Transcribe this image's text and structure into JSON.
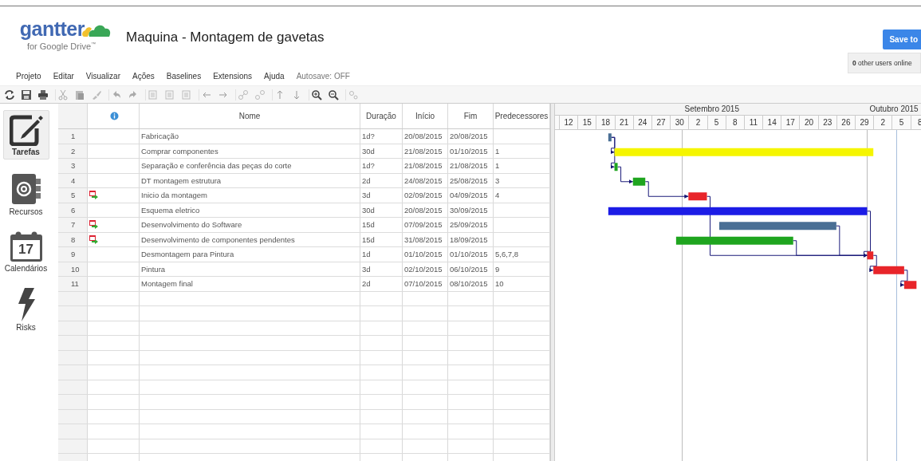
{
  "logo": {
    "name": "gantter",
    "subtitle": "for Google Drive$^{™}$"
  },
  "document_title": "Maquina - Montagem de gavetas",
  "save_button": "Save to",
  "online_users": {
    "count": "0",
    "label": "other users online"
  },
  "menu": [
    "Projeto",
    "Editar",
    "Visualizar",
    "Ações",
    "Baselines",
    "Extensions",
    "Ajuda"
  ],
  "autosave": "Autosave: OFF",
  "sidebar": {
    "items": [
      {
        "kind": "tasks",
        "label": "Tarefas",
        "selected": true
      },
      {
        "kind": "resources",
        "label": "Recursos",
        "selected": false
      },
      {
        "kind": "calendar",
        "label": "Calendários",
        "icon_text": "17",
        "selected": false
      },
      {
        "kind": "risks",
        "label": "Risks",
        "selected": false
      }
    ]
  },
  "table": {
    "columns": [
      "Nome",
      "Duração",
      "Início",
      "Fim",
      "Predecessores"
    ],
    "rows": [
      {
        "number": "1",
        "constraint": false,
        "name": "Fabricação",
        "duration": "1d?",
        "start": "20/08/2015",
        "end": "20/08/2015",
        "predecessors": "",
        "color": "#4a6f95"
      },
      {
        "number": "2",
        "constraint": false,
        "name": "Comprar componentes",
        "duration": "30d",
        "start": "21/08/2015",
        "end": "01/10/2015",
        "predecessors": "1",
        "color": "#f5f500"
      },
      {
        "number": "3",
        "constraint": false,
        "name": "Separação e conferência das peças do corte",
        "duration": "1d?",
        "start": "21/08/2015",
        "end": "21/08/2015",
        "predecessors": "1",
        "color": "#1fa51f"
      },
      {
        "number": "4",
        "constraint": false,
        "name": "DT montagem estrutura",
        "duration": "2d",
        "start": "24/08/2015",
        "end": "25/08/2015",
        "predecessors": "3",
        "color": "#1fa51f"
      },
      {
        "number": "5",
        "constraint": true,
        "name": "Inicio da montagem",
        "duration": "3d",
        "start": "02/09/2015",
        "end": "04/09/2015",
        "predecessors": "4",
        "color": "#e8252a"
      },
      {
        "number": "6",
        "constraint": false,
        "name": "Esquema eletrico",
        "duration": "30d",
        "start": "20/08/2015",
        "end": "30/09/2015",
        "predecessors": "",
        "color": "#1c1ce6"
      },
      {
        "number": "7",
        "constraint": true,
        "name": "Desenvolvimento do Software",
        "duration": "15d",
        "start": "07/09/2015",
        "end": "25/09/2015",
        "predecessors": "",
        "color": "#4a6f95"
      },
      {
        "number": "8",
        "constraint": true,
        "name": "Desenvolvimento de componentes pendentes",
        "duration": "15d",
        "start": "31/08/2015",
        "end": "18/09/2015",
        "predecessors": "",
        "color": "#1fa51f"
      },
      {
        "number": "9",
        "constraint": false,
        "name": "Desmontagem para Pintura",
        "duration": "1d",
        "start": "01/10/2015",
        "end": "01/10/2015",
        "predecessors": "5,6,7,8",
        "color": "#e8252a"
      },
      {
        "number": "10",
        "constraint": false,
        "name": "Pintura",
        "duration": "3d",
        "start": "02/10/2015",
        "end": "06/10/2015",
        "predecessors": "9",
        "color": "#e8252a"
      },
      {
        "number": "11",
        "constraint": false,
        "name": "Montagem final",
        "duration": "2d",
        "start": "07/10/2015",
        "end": "08/10/2015",
        "predecessors": "10",
        "color": "#e8252a"
      }
    ]
  },
  "timeline": {
    "months": [
      "Setembro 2015",
      "Outubro 2015"
    ],
    "days": [
      "12",
      "15",
      "18",
      "21",
      "24",
      "27",
      "30",
      "2",
      "5",
      "8",
      "11",
      "14",
      "17",
      "20",
      "23",
      "26",
      "29",
      "2",
      "5",
      "8"
    ]
  }
}
